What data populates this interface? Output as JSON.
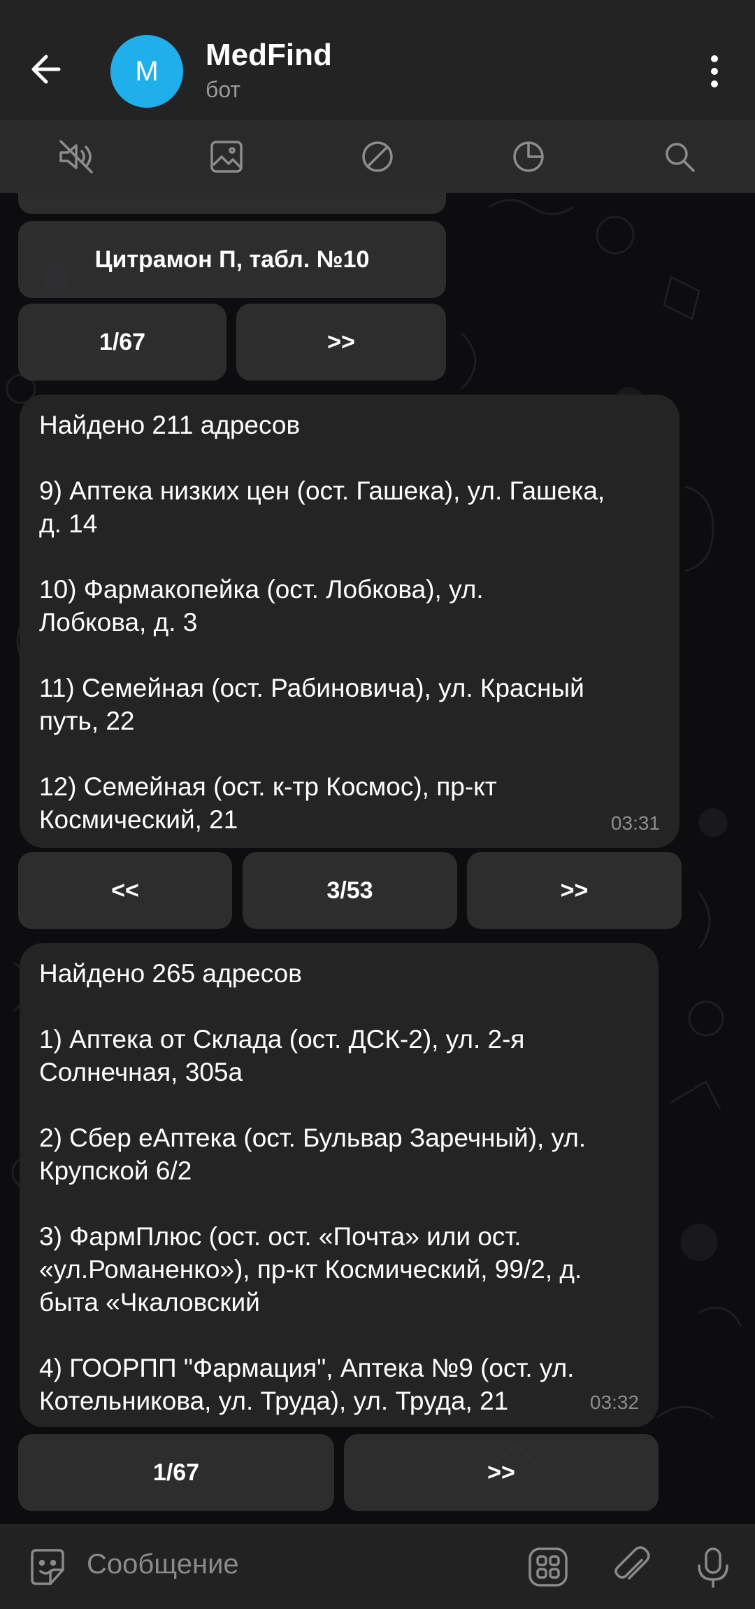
{
  "header": {
    "title": "MedFind",
    "subtitle": "бот",
    "avatar_letter": "M",
    "avatar_color": "#1fb0ec"
  },
  "toolbar": {
    "icons": [
      "mute-icon",
      "media-icon",
      "block-icon",
      "timer-icon",
      "search-icon"
    ]
  },
  "top_keyboard": {
    "item_label": "Цитрамон П, табл. №10",
    "page": "1/67",
    "next": ">>"
  },
  "message1": {
    "lines": [
      "Найдено 211 адресов",
      "",
      "9) Аптека низких цен (ост. Гашека), ул. Гашека,",
      "д. 14",
      "",
      "10) Фармакопейка (ост. Лобкова), ул.",
      "Лобкова, д. 3",
      "",
      "11) Семейная (ост. Рабиновича), ул. Красный",
      "путь, 22",
      "",
      "12) Семейная (ост. к-тр Космос), пр-кт",
      "Космический, 21"
    ],
    "time": "03:31"
  },
  "keyboard1": {
    "prev": "<<",
    "page": "3/53",
    "next": ">>"
  },
  "message2": {
    "lines": [
      "Найдено 265 адресов",
      "",
      "1) Аптека от Склада (ост. ДСК-2), ул. 2-я",
      "Солнечная, 305а",
      "",
      "2) Сбер еАптека (ост. Бульвар Заречный), ул.",
      "Крупской 6/2",
      "",
      "3) ФармПлюс (ост. ост. «Почта» или ост.",
      "«ул.Романенко»), пр-кт Космический, 99/2, д.",
      "быта «Чкаловский",
      "",
      "4) ГООРПП \"Фармация\", Аптека №9 (ост. ул.",
      "Котельникова, ул. Труда), ул. Труда, 21"
    ],
    "time": "03:32"
  },
  "keyboard2": {
    "page": "1/67",
    "next": ">>"
  },
  "composer": {
    "placeholder": "Сообщение",
    "icons": [
      "sticker-icon",
      "bot-menu-icon",
      "attach-icon",
      "microphone-icon"
    ]
  }
}
